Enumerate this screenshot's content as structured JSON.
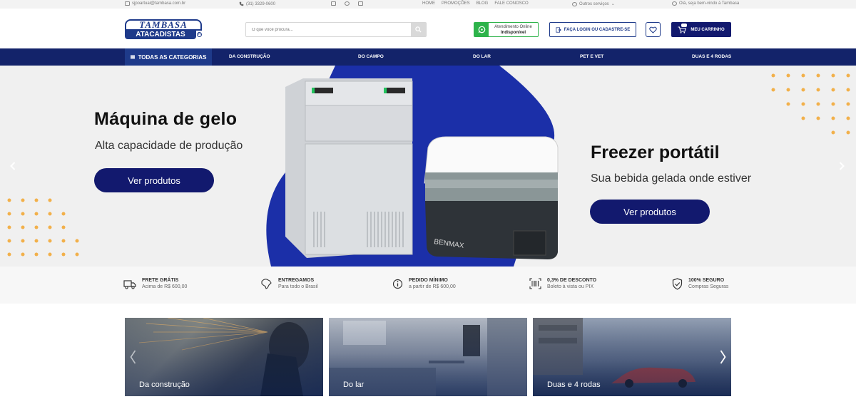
{
  "topbar": {
    "email": "sjpoartual@tambasa.com.br",
    "phone": "(31) 3329-0600",
    "links": [
      "HOME",
      "PROMOÇÕES",
      "BLOG",
      "FALE CONOSCO"
    ],
    "services": "Outros serviços",
    "greeting": "Olá, seja bem-vindo à Tambasa"
  },
  "header": {
    "logo_top": "TAMBASA",
    "logo_bottom": "ATACADISTAS",
    "logo_reg": "R",
    "search_placeholder": "O que você procura...",
    "whatsapp_line1": "Atendimento Online",
    "whatsapp_line2": "Indisponível",
    "login_label": "FAÇA LOGIN OU CADASTRE-SE",
    "cart_label": "MEU CARRINHO"
  },
  "nav": {
    "all_categories": "TODAS AS CATEGORIAS",
    "categories": [
      "DA CONSTRUÇÃO",
      "DO CAMPO",
      "DO LAR",
      "PET E VET",
      "DUAS E 4 RODAS"
    ]
  },
  "hero": {
    "left_title": "Máquina de gelo",
    "left_subtitle": "Alta capacidade de produção",
    "left_button": "Ver produtos",
    "right_title": "Freezer portátil",
    "right_subtitle": "Sua bebida gelada onde estiver",
    "right_button": "Ver produtos",
    "product_brand": "BENMAX",
    "accent_color": "#1b2fa8",
    "dot_color": "#f2b04a"
  },
  "benefits": [
    {
      "icon": "truck-icon",
      "title": "FRETE GRÁTIS",
      "subtitle": "Acima de R$ 600,00"
    },
    {
      "icon": "brazil-map-icon",
      "title": "ENTREGAMOS",
      "subtitle": "Para todo o Brasil"
    },
    {
      "icon": "info-icon",
      "title": "PEDIDO MÍNIMO",
      "subtitle": "a partir de R$ 600,00"
    },
    {
      "icon": "barcode-icon",
      "title": "0,3% DE DESCONTO",
      "subtitle": "Boleto à vista ou PIX"
    },
    {
      "icon": "shield-icon",
      "title": "100% SEGURO",
      "subtitle": "Compras Seguras"
    }
  ],
  "cards": [
    {
      "label": "Da construção"
    },
    {
      "label": "Do lar"
    },
    {
      "label": "Duas e 4 rodas"
    }
  ]
}
